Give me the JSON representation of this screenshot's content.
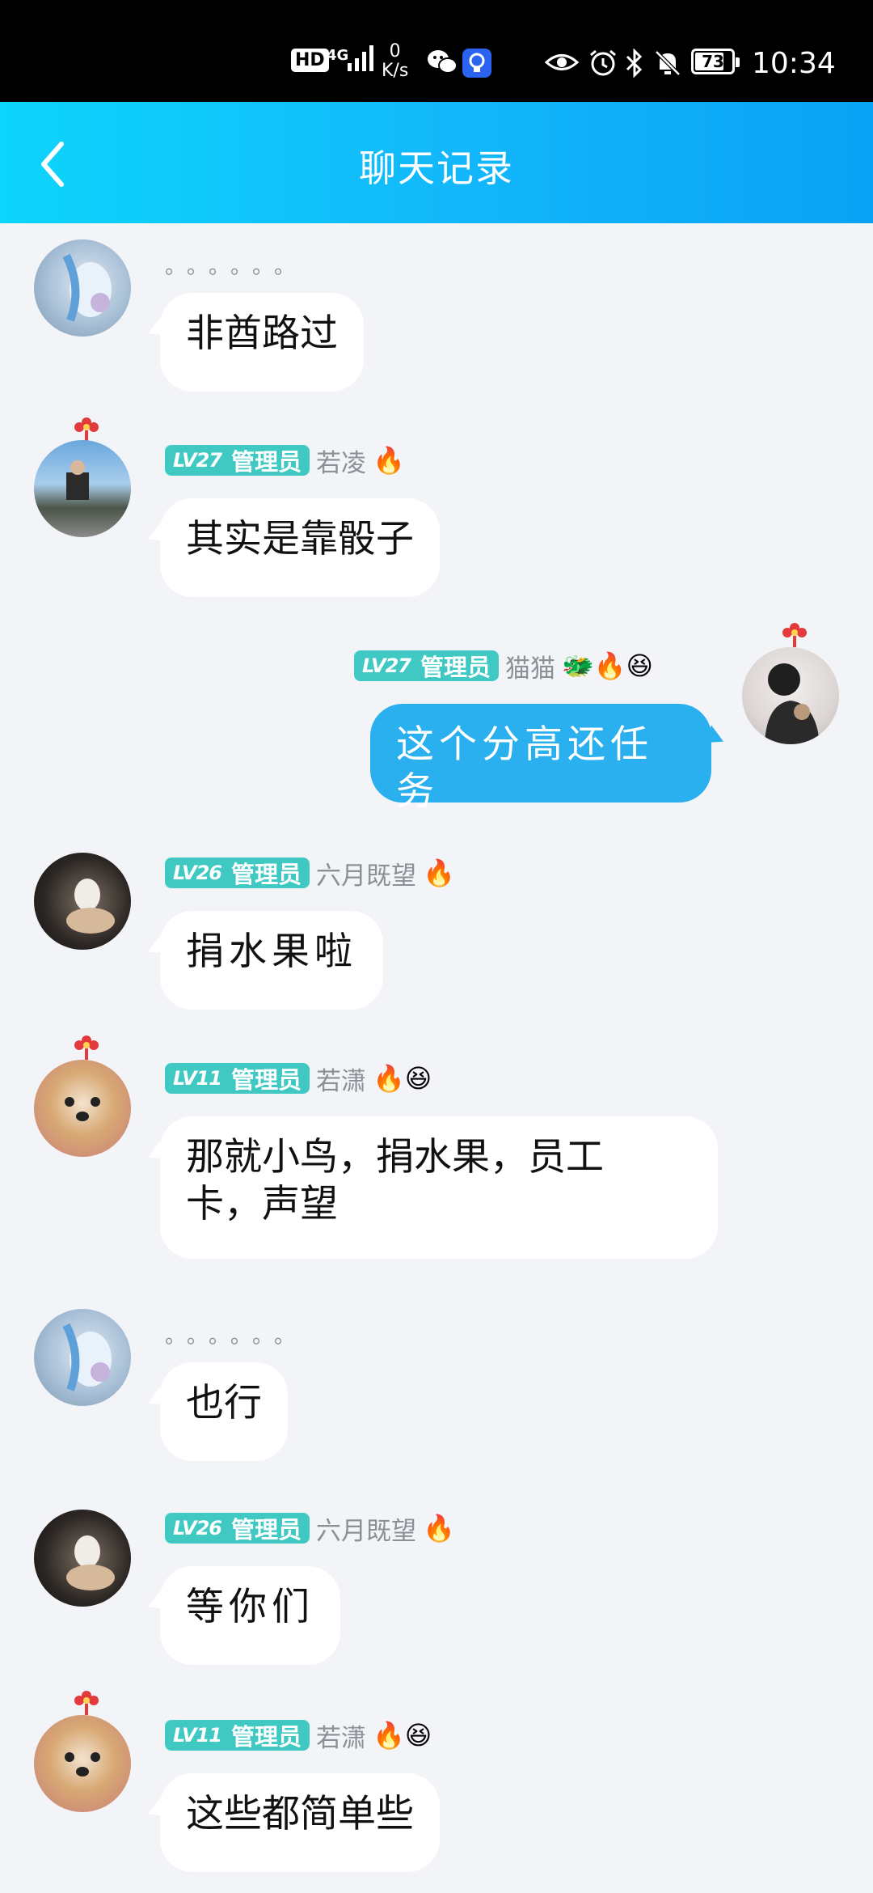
{
  "status_bar": {
    "hd": "HD",
    "network": "4G",
    "speed_value": "0",
    "speed_unit": "K/s",
    "battery": "73",
    "time": "10:34"
  },
  "header": {
    "title": "聊天记录"
  },
  "messages": [
    {
      "nick": "。。。。。。",
      "text": "非酋路过"
    },
    {
      "badge_lv": "LV27",
      "badge_role": "管理员",
      "nick": "若凌",
      "emoji": "🔥",
      "text": "其实是靠骰子"
    },
    {
      "badge_lv": "LV27",
      "badge_role": "管理员",
      "nick": "猫猫",
      "emoji": "🐲🔥😆",
      "text": "这个分高还任务"
    },
    {
      "badge_lv": "LV26",
      "badge_role": "管理员",
      "nick": "六月既望",
      "emoji": "🔥",
      "text": "捐水果啦"
    },
    {
      "badge_lv": "LV11",
      "badge_role": "管理员",
      "nick": "若潇",
      "emoji": "🔥😆",
      "text_line1": "那就小鸟，捐水果，员工",
      "text_line2": "卡，声望"
    },
    {
      "nick": "。。。。。。",
      "text": "也行"
    },
    {
      "badge_lv": "LV26",
      "badge_role": "管理员",
      "nick": "六月既望",
      "emoji": "🔥",
      "text": "等你们"
    },
    {
      "badge_lv": "LV11",
      "badge_role": "管理员",
      "nick": "若潇",
      "emoji": "🔥😆",
      "text": "这些都简单些"
    }
  ],
  "colors": {
    "header_start": "#0dd5fb",
    "header_end": "#0aa2f5",
    "badge": "#40c9c3",
    "self_bubble": "#2aafef",
    "background": "#f3f4f8"
  }
}
